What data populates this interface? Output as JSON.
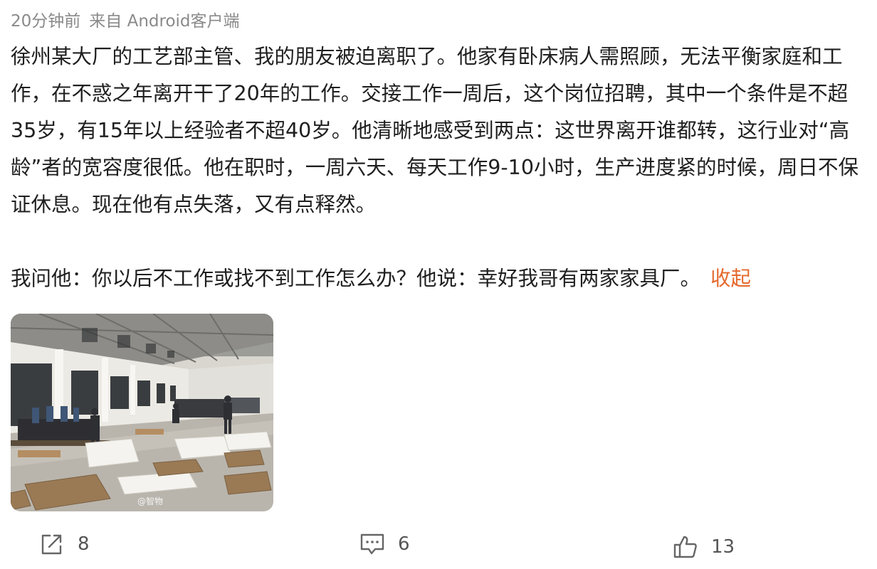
{
  "meta": {
    "time": "20分钟前",
    "source": "来自 Android客户端"
  },
  "content": {
    "paragraph1": "徐州某大厂的工艺部主管、我的朋友被迫离职了。他家有卧床病人需照顾，无法平衡家庭和工作，在不惑之年离开干了20年的工作。交接工作一周后，这个岗位招聘，其中一个条件是不超35岁，有15年以上经验者不超40岁。他清晰地感受到两点：这世界离开谁都转，这行业对“高龄”者的宽容度很低。他在职时，一周六天、每天工作9-10小时，生产进度紧的时候，周日不保证休息。现在他有点失落，又有点释然。",
    "paragraph2": "我问他：你以后不工作或找不到工作怎么办？他说：幸好我哥有两家家具厂。",
    "collapse_label": "收起"
  },
  "image": {
    "watermark": "@智物",
    "icon": "factory-photo"
  },
  "actions": {
    "share": {
      "icon": "share-icon",
      "count": "8"
    },
    "comment": {
      "icon": "comment-icon",
      "count": "6"
    },
    "like": {
      "icon": "thumbs-up-icon",
      "count": "13"
    }
  },
  "colors": {
    "accent": "#e5692d",
    "meta_text": "#8a8a8a",
    "body_text": "#1f1f1f",
    "icon": "#666666"
  }
}
